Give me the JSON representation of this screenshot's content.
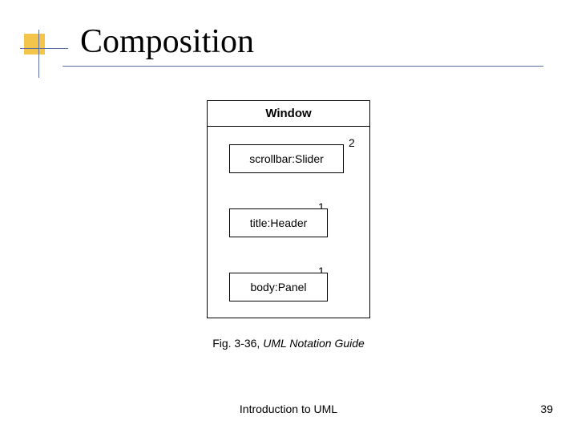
{
  "title": "Composition",
  "uml": {
    "class_name": "Window",
    "parts": [
      {
        "label": "scrollbar:Slider",
        "mult": "2"
      },
      {
        "label": "title:Header",
        "mult": "1"
      },
      {
        "label": "body:Panel",
        "mult": "1"
      }
    ]
  },
  "caption": {
    "fig": "Fig. 3-36, ",
    "source": "UML Notation Guide"
  },
  "footer": {
    "center": "Introduction to UML",
    "page": "39"
  }
}
